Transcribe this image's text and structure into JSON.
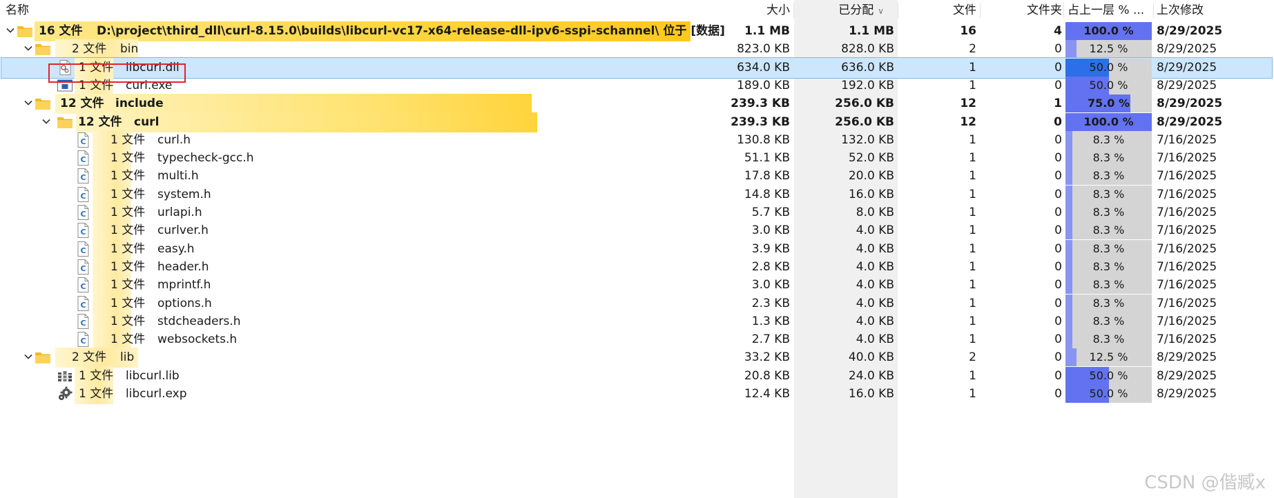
{
  "columns": {
    "name": "名称",
    "size": "大小",
    "allocated": "已分配",
    "files": "文件",
    "folders": "文件夹",
    "percent": "占上一层 % ...",
    "modified": "上次修改"
  },
  "icons": [
    "chevron-down-icon",
    "folder-icon",
    "dll-file-icon",
    "exe-file-icon",
    "c-header-file-icon",
    "lib-file-icon",
    "gear-file-icon",
    "sort-desc-icon"
  ],
  "colors": {
    "folder": "#f9c93e",
    "highlight_bar": "#ffd43b",
    "percent_fill": "#5a6cf2",
    "percent_track": "#d4d4d4",
    "selected_bg": "#cde6fb"
  },
  "rows": [
    {
      "count": "16 文件",
      "name": "D:\\project\\third_dll\\curl-8.15.0\\builds\\libcurl-vc17-x64-release-dll-ipv6-sspi-schannel\\  位于 [数据]",
      "size": "1.1 MB",
      "allocated": "1.1 MB",
      "files": "16",
      "folders": "4",
      "percent": "100.0 %",
      "percent_value": 100,
      "modified": "8/29/2025"
    },
    {
      "count": "2 文件",
      "name": "bin",
      "size": "823.0 KB",
      "allocated": "828.0 KB",
      "files": "2",
      "folders": "0",
      "percent": "12.5 %",
      "percent_value": 12.5,
      "modified": "8/29/2025"
    },
    {
      "count": "1 文件",
      "name": "libcurl.dll",
      "size": "634.0 KB",
      "allocated": "636.0 KB",
      "files": "1",
      "folders": "0",
      "percent": "50.0 %",
      "percent_value": 50,
      "modified": "8/29/2025"
    },
    {
      "count": "1 文件",
      "name": "curl.exe",
      "size": "189.0 KB",
      "allocated": "192.0 KB",
      "files": "1",
      "folders": "0",
      "percent": "50.0 %",
      "percent_value": 50,
      "modified": "8/29/2025"
    },
    {
      "count": "12 文件",
      "name": "include",
      "size": "239.3 KB",
      "allocated": "256.0 KB",
      "files": "12",
      "folders": "1",
      "percent": "75.0 %",
      "percent_value": 75,
      "modified": "8/29/2025"
    },
    {
      "count": "12 文件",
      "name": "curl",
      "size": "239.3 KB",
      "allocated": "256.0 KB",
      "files": "12",
      "folders": "0",
      "percent": "100.0 %",
      "percent_value": 100,
      "modified": "8/29/2025"
    },
    {
      "count": "1 文件",
      "name": "curl.h",
      "size": "130.8 KB",
      "allocated": "132.0 KB",
      "files": "1",
      "folders": "0",
      "percent": "8.3 %",
      "percent_value": 8.3,
      "modified": "7/16/2025"
    },
    {
      "count": "1 文件",
      "name": "typecheck-gcc.h",
      "size": "51.1 KB",
      "allocated": "52.0 KB",
      "files": "1",
      "folders": "0",
      "percent": "8.3 %",
      "percent_value": 8.3,
      "modified": "7/16/2025"
    },
    {
      "count": "1 文件",
      "name": "multi.h",
      "size": "17.8 KB",
      "allocated": "20.0 KB",
      "files": "1",
      "folders": "0",
      "percent": "8.3 %",
      "percent_value": 8.3,
      "modified": "7/16/2025"
    },
    {
      "count": "1 文件",
      "name": "system.h",
      "size": "14.8 KB",
      "allocated": "16.0 KB",
      "files": "1",
      "folders": "0",
      "percent": "8.3 %",
      "percent_value": 8.3,
      "modified": "7/16/2025"
    },
    {
      "count": "1 文件",
      "name": "urlapi.h",
      "size": "5.7 KB",
      "allocated": "8.0 KB",
      "files": "1",
      "folders": "0",
      "percent": "8.3 %",
      "percent_value": 8.3,
      "modified": "7/16/2025"
    },
    {
      "count": "1 文件",
      "name": "curlver.h",
      "size": "3.0 KB",
      "allocated": "4.0 KB",
      "files": "1",
      "folders": "0",
      "percent": "8.3 %",
      "percent_value": 8.3,
      "modified": "7/16/2025"
    },
    {
      "count": "1 文件",
      "name": "easy.h",
      "size": "3.9 KB",
      "allocated": "4.0 KB",
      "files": "1",
      "folders": "0",
      "percent": "8.3 %",
      "percent_value": 8.3,
      "modified": "7/16/2025"
    },
    {
      "count": "1 文件",
      "name": "header.h",
      "size": "2.8 KB",
      "allocated": "4.0 KB",
      "files": "1",
      "folders": "0",
      "percent": "8.3 %",
      "percent_value": 8.3,
      "modified": "7/16/2025"
    },
    {
      "count": "1 文件",
      "name": "mprintf.h",
      "size": "3.0 KB",
      "allocated": "4.0 KB",
      "files": "1",
      "folders": "0",
      "percent": "8.3 %",
      "percent_value": 8.3,
      "modified": "7/16/2025"
    },
    {
      "count": "1 文件",
      "name": "options.h",
      "size": "2.3 KB",
      "allocated": "4.0 KB",
      "files": "1",
      "folders": "0",
      "percent": "8.3 %",
      "percent_value": 8.3,
      "modified": "7/16/2025"
    },
    {
      "count": "1 文件",
      "name": "stdcheaders.h",
      "size": "1.3 KB",
      "allocated": "4.0 KB",
      "files": "1",
      "folders": "0",
      "percent": "8.3 %",
      "percent_value": 8.3,
      "modified": "7/16/2025"
    },
    {
      "count": "1 文件",
      "name": "websockets.h",
      "size": "2.7 KB",
      "allocated": "4.0 KB",
      "files": "1",
      "folders": "0",
      "percent": "8.3 %",
      "percent_value": 8.3,
      "modified": "7/16/2025"
    },
    {
      "count": "2 文件",
      "name": "lib",
      "size": "33.2 KB",
      "allocated": "40.0 KB",
      "files": "2",
      "folders": "0",
      "percent": "12.5 %",
      "percent_value": 12.5,
      "modified": "8/29/2025"
    },
    {
      "count": "1 文件",
      "name": "libcurl.lib",
      "size": "20.8 KB",
      "allocated": "24.0 KB",
      "files": "1",
      "folders": "0",
      "percent": "50.0 %",
      "percent_value": 50,
      "modified": "8/29/2025"
    },
    {
      "count": "1 文件",
      "name": "libcurl.exp",
      "size": "12.4 KB",
      "allocated": "16.0 KB",
      "files": "1",
      "folders": "0",
      "percent": "50.0 %",
      "percent_value": 50,
      "modified": "8/29/2025"
    }
  ],
  "watermark": "CSDN @偕臧x"
}
